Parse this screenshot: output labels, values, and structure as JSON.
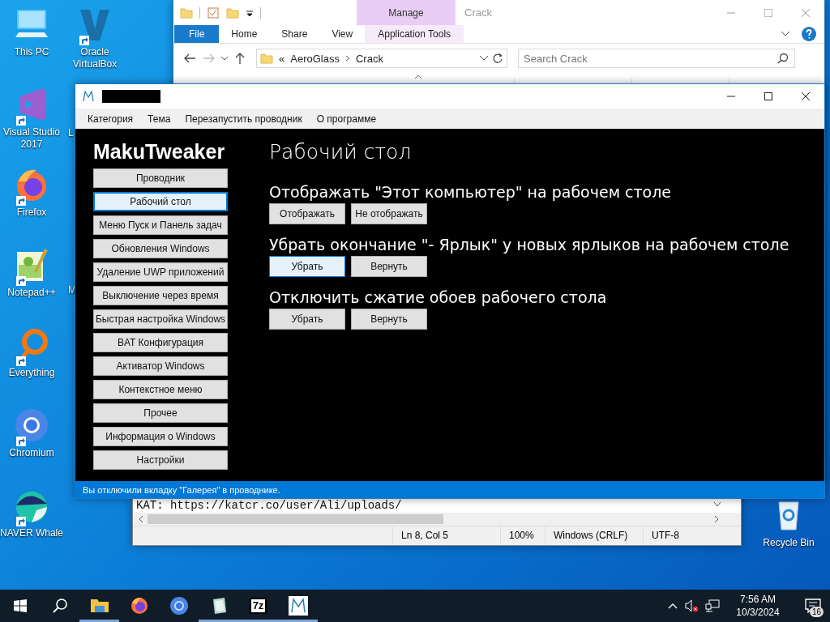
{
  "desktop_icons": [
    {
      "kind": "pc",
      "label": "This PC",
      "shortcut": false
    },
    {
      "kind": "vs",
      "label": "Visual Studio 2017",
      "shortcut": true
    },
    {
      "kind": "firefox",
      "label": "Firefox",
      "shortcut": true
    },
    {
      "kind": "notepadpp",
      "label": "Notepad++",
      "shortcut": true
    },
    {
      "kind": "everything",
      "label": "Everything",
      "shortcut": true
    },
    {
      "kind": "chromium",
      "label": "Chromium",
      "shortcut": true
    },
    {
      "kind": "whale",
      "label": "NAVER Whale",
      "shortcut": true
    },
    {
      "kind": "virtualbox",
      "label": "Oracle VirtualBox",
      "shortcut": true
    },
    {
      "kind": "covered",
      "label": "L",
      "shortcut": false
    },
    {
      "kind": "covered",
      "label": "M",
      "shortcut": false
    }
  ],
  "recycle_bin": {
    "label": "Recycle Bin"
  },
  "explorer": {
    "title": "Crack",
    "context_group": "Manage",
    "ribbon_tabs": [
      {
        "label": "File",
        "kind": "file"
      },
      {
        "label": "Home",
        "kind": "tab"
      },
      {
        "label": "Share",
        "kind": "tab"
      },
      {
        "label": "View",
        "kind": "tab"
      },
      {
        "label": "Application Tools",
        "kind": "context"
      }
    ],
    "path_prefix": "«",
    "path": [
      "AeroGlass",
      "Crack"
    ],
    "search": {
      "placeholder": "Search Crack"
    }
  },
  "notepad": {
    "lines": [
      "KAT: https://katcr.co/user/Ali/uploads/"
    ],
    "status": [
      "Ln 8, Col 5",
      "100%",
      "Windows (CRLF)",
      "UTF-8"
    ]
  },
  "app": {
    "menu": [
      "Категория",
      "Тема",
      "Перезапустить проводник",
      "О программе"
    ],
    "brand": "MakuTweaker",
    "nav": [
      {
        "label": "Проводник",
        "selected": false
      },
      {
        "label": "Рабочий стол",
        "selected": true
      },
      {
        "label": "Меню Пуск и Панель задач",
        "selected": false
      },
      {
        "label": "Обновления Windows",
        "selected": false
      },
      {
        "label": "Удаление UWP приложений",
        "selected": false
      },
      {
        "label": "Выключение через время",
        "selected": false
      },
      {
        "label": "Быстрая настройка Windows",
        "selected": false
      },
      {
        "label": "BAT Конфигурация",
        "selected": false
      },
      {
        "label": "Активатор Windows",
        "selected": false
      },
      {
        "label": "Контекстное меню",
        "selected": false
      },
      {
        "label": "Прочее",
        "selected": false
      },
      {
        "label": "Информация о Windows",
        "selected": false
      },
      {
        "label": "Настройки",
        "selected": false
      }
    ],
    "page_title": "Рабочий стол",
    "sections": [
      {
        "title": "Отображать \"Этот компьютер\" на рабочем столе",
        "buttons": [
          {
            "label": "Отображать",
            "hovered": false
          },
          {
            "label": "Не отображать",
            "hovered": false
          }
        ]
      },
      {
        "title": "Убрать окончание \"- Ярлык\" у новых ярлыков на рабочем столе",
        "buttons": [
          {
            "label": "Убрать",
            "hovered": true
          },
          {
            "label": "Вернуть",
            "hovered": false
          }
        ]
      },
      {
        "title": "Отключить сжатие обоев рабочего стола",
        "buttons": [
          {
            "label": "Убрать",
            "hovered": false
          },
          {
            "label": "Вернуть",
            "hovered": false
          }
        ]
      }
    ],
    "status": "Вы отключили вкладку \"Галерея\" в проводнике."
  },
  "taskbar": {
    "apps": [
      {
        "kind": "explorer",
        "running": true
      },
      {
        "kind": "firefox",
        "running": false
      },
      {
        "kind": "chromium",
        "running": false
      },
      {
        "kind": "notepad",
        "running": true
      },
      {
        "kind": "sevenzip",
        "label": "7z",
        "running": true
      },
      {
        "kind": "maku",
        "running": true
      }
    ],
    "time": "7:56 AM",
    "date": "10/3/2024",
    "notifications": "16"
  }
}
